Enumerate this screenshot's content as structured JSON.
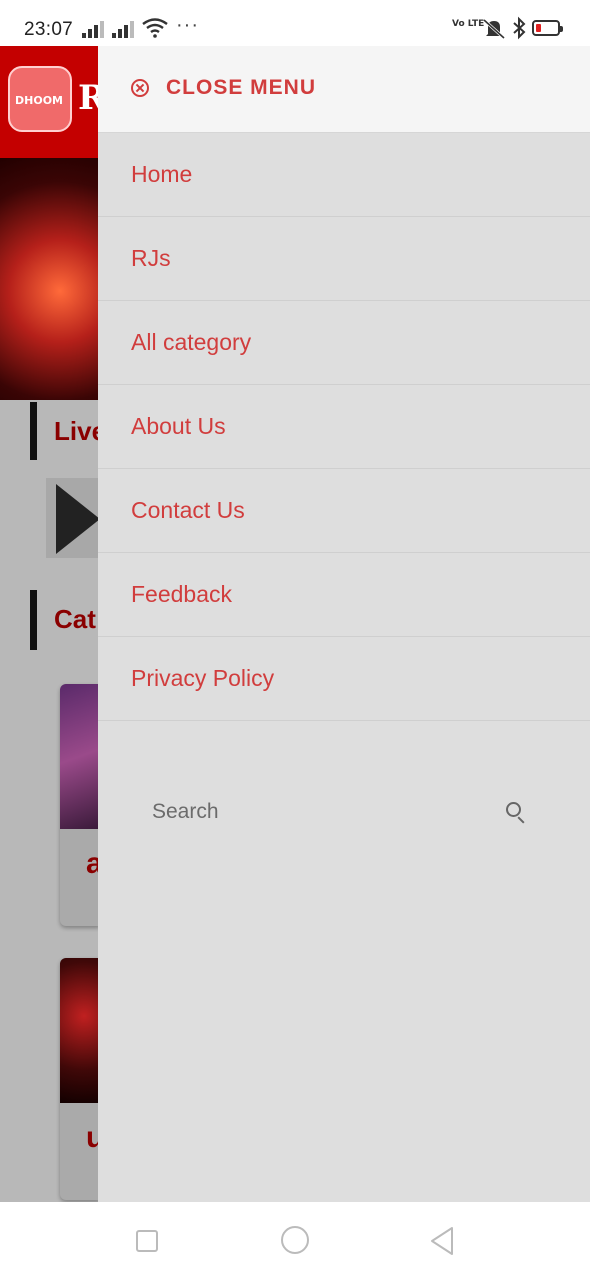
{
  "status_bar": {
    "time": "23:07",
    "more": "···",
    "network_label": "Vo LTE",
    "battery_level": 0.15
  },
  "background": {
    "logo_text": "DHOOM",
    "title_initial": "R",
    "live_section": "Live",
    "category_section": "Cat",
    "card_letters": [
      "a",
      "u"
    ]
  },
  "drawer": {
    "close_label": "CLOSE MENU",
    "menu_items": [
      {
        "label": "Home"
      },
      {
        "label": "RJs"
      },
      {
        "label": "All category"
      },
      {
        "label": "About Us"
      },
      {
        "label": "Contact Us"
      },
      {
        "label": "Feedback"
      },
      {
        "label": "Privacy Policy"
      }
    ],
    "search": {
      "placeholder": "Search"
    }
  },
  "colors": {
    "accent": "#d13d3d",
    "header_red": "#c40000",
    "drawer_bg": "#dedede"
  }
}
